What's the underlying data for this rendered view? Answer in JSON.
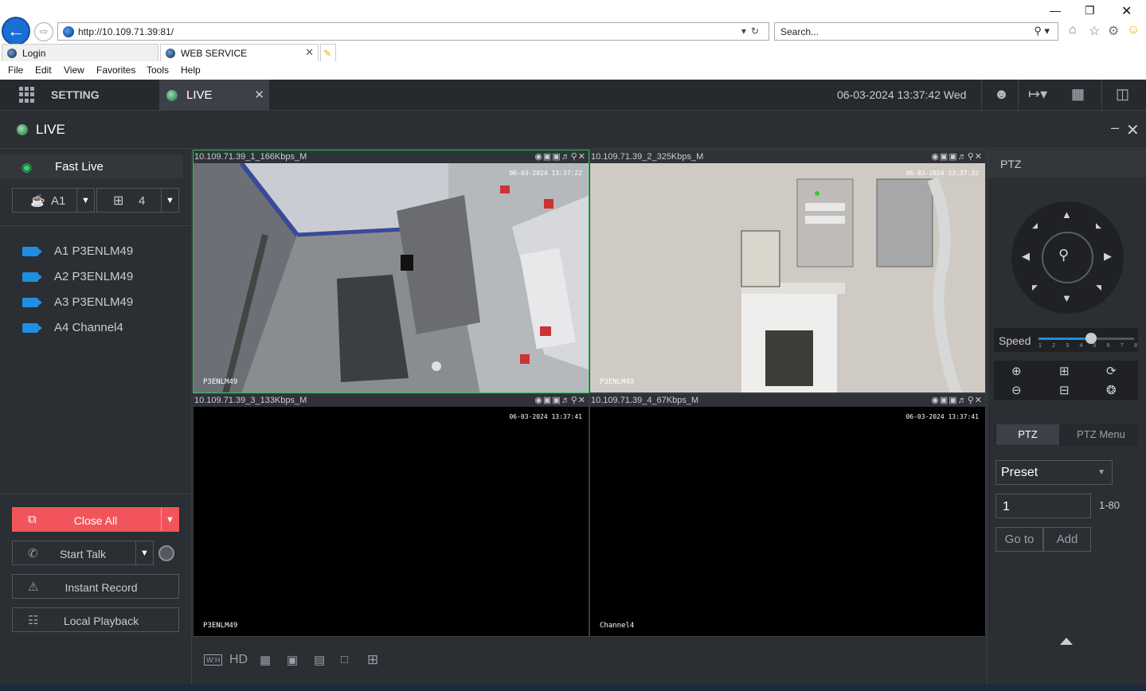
{
  "browser": {
    "url": "http://10.109.71.39:81/",
    "search_placeholder": "Search...",
    "tabs": [
      {
        "label": "Login"
      },
      {
        "label": "WEB SERVICE"
      }
    ],
    "menu": [
      "File",
      "Edit",
      "View",
      "Favorites",
      "Tools",
      "Help"
    ]
  },
  "app": {
    "setting_label": "SETTING",
    "live_tab_label": "LIVE",
    "datetime": "06-03-2024 13:37:42 Wed",
    "panel_title": "LIVE"
  },
  "left": {
    "fast_live": "Fast Live",
    "group_select": "A1",
    "layout_select": "4",
    "channels": [
      {
        "label": "A1 P3ENLM49"
      },
      {
        "label": "A2 P3ENLM49"
      },
      {
        "label": "A3 P3ENLM49"
      },
      {
        "label": "A4 Channel4"
      }
    ],
    "buttons": {
      "close_all": "Close All",
      "start_talk": "Start Talk",
      "instant_record": "Instant Record",
      "local_playback": "Local Playback"
    }
  },
  "video": {
    "panes": [
      {
        "title": "10.109.71.39_1_166Kbps_M",
        "timestamp": "06-03-2024 13:37:22",
        "name": "P3ENLM49"
      },
      {
        "title": "10.109.71.39_2_325Kbps_M",
        "timestamp": "06-03-2024 13:37:32",
        "name": "P3ENLM49"
      },
      {
        "title": "10.109.71.39_3_133Kbps_M",
        "timestamp": "06-03-2024 13:37:41",
        "name": "P3ENLM49"
      },
      {
        "title": "10.109.71.39_4_67Kbps_M",
        "timestamp": "06-03-2024 13:37:41",
        "name": "Channel4"
      }
    ],
    "bottom_tools": {
      "hd": "HD",
      "wh": "W:H"
    }
  },
  "ptz": {
    "header": "PTZ",
    "speed_label": "Speed",
    "speed_value": 5,
    "speed_ticks": [
      "1",
      "2",
      "3",
      "4",
      "5",
      "6",
      "7",
      "8"
    ],
    "tab_ptz": "PTZ",
    "tab_menu": "PTZ Menu",
    "preset_select": "Preset",
    "preset_number": "1",
    "preset_range": "1-80",
    "goto": "Go to",
    "add": "Add"
  }
}
